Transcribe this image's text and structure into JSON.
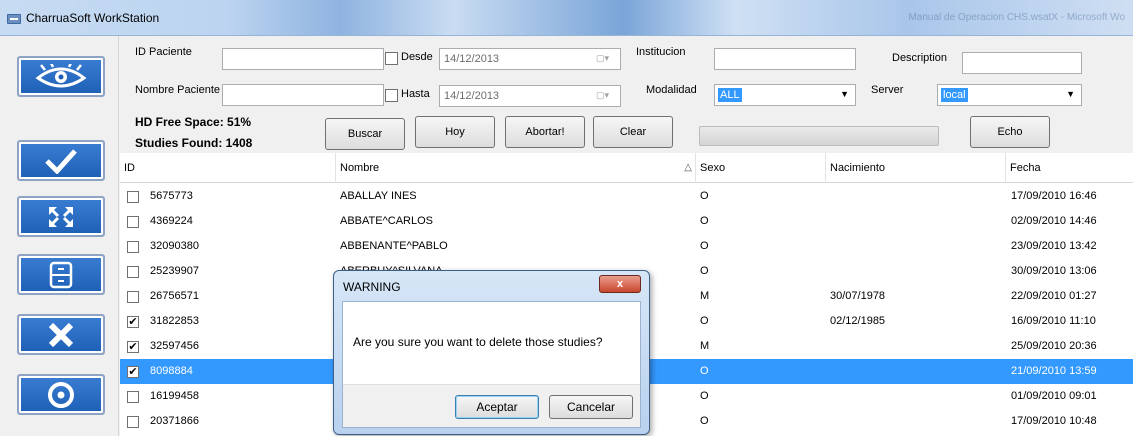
{
  "window": {
    "title": "CharruaSoft WorkStation",
    "ghost_title": "Manual de Operacion CHS.wsatX - Microsoft Wo"
  },
  "sidebar": {
    "buttons": [
      {
        "name": "view-button",
        "icon": "eye-icon"
      },
      {
        "name": "select-button",
        "icon": "checkmark-icon"
      },
      {
        "name": "expand-button",
        "icon": "expand-icon"
      },
      {
        "name": "archive-button",
        "icon": "cabinet-icon"
      },
      {
        "name": "delete-button",
        "icon": "close-icon"
      },
      {
        "name": "burn-cd-button",
        "icon": "disc-icon"
      }
    ]
  },
  "search": {
    "id_paciente_label": "ID Paciente",
    "id_paciente_value": "",
    "nombre_paciente_label": "Nombre Paciente",
    "nombre_paciente_value": "",
    "desde_label": "Desde",
    "desde_value": "14/12/2013",
    "hasta_label": "Hasta",
    "hasta_value": "14/12/2013",
    "institucion_label": "Institucion",
    "institucion_value": "",
    "description_label": "Description",
    "description_value": "",
    "modalidad_label": "Modalidad",
    "modalidad_value": "ALL",
    "server_label": "Server",
    "server_value": "local",
    "hd_free_space": "HD Free Space: 51%",
    "studies_found": "Studies Found: 1408",
    "buttons": {
      "buscar": "Buscar",
      "hoy": "Hoy",
      "abortar": "Abortar!",
      "clear": "Clear",
      "echo": "Echo"
    }
  },
  "grid": {
    "columns": [
      "ID",
      "Nombre",
      "Sexo",
      "Nacimiento",
      "Fecha"
    ],
    "sort_column": "Sexo",
    "rows": [
      {
        "checked": false,
        "selected": false,
        "id": "5675773",
        "nombre": "ABALLAY INES",
        "sexo": "O",
        "nacimiento": "",
        "fecha": "17/09/2010 16:46"
      },
      {
        "checked": false,
        "selected": false,
        "id": "4369224",
        "nombre": "ABBATE^CARLOS",
        "sexo": "O",
        "nacimiento": "",
        "fecha": "02/09/2010 14:46"
      },
      {
        "checked": false,
        "selected": false,
        "id": "32090380",
        "nombre": "ABBENANTE^PABLO",
        "sexo": "O",
        "nacimiento": "",
        "fecha": "23/09/2010 13:42"
      },
      {
        "checked": false,
        "selected": false,
        "id": "25239907",
        "nombre": "ABERBUY^SILVANA",
        "sexo": "O",
        "nacimiento": "",
        "fecha": "30/09/2010 13:06"
      },
      {
        "checked": false,
        "selected": false,
        "id": "26756571",
        "nombre": "",
        "sexo": "M",
        "nacimiento": "30/07/1978",
        "fecha": "22/09/2010 01:27"
      },
      {
        "checked": true,
        "selected": false,
        "id": "31822853",
        "nombre": "",
        "sexo": "O",
        "nacimiento": "02/12/1985",
        "fecha": "16/09/2010 11:10"
      },
      {
        "checked": true,
        "selected": false,
        "id": "32597456",
        "nombre": "",
        "sexo": "M",
        "nacimiento": "",
        "fecha": "25/09/2010 20:36"
      },
      {
        "checked": true,
        "selected": true,
        "id": "8098884",
        "nombre": "",
        "sexo": "O",
        "nacimiento": "",
        "fecha": "21/09/2010 13:59"
      },
      {
        "checked": false,
        "selected": false,
        "id": "16199458",
        "nombre": "",
        "sexo": "O",
        "nacimiento": "",
        "fecha": "01/09/2010 09:01"
      },
      {
        "checked": false,
        "selected": false,
        "id": "20371866",
        "nombre": "",
        "sexo": "O",
        "nacimiento": "",
        "fecha": "17/09/2010 10:48"
      }
    ]
  },
  "dialog": {
    "title": "WARNING",
    "close_label": "x",
    "message": "Are you sure you want to delete those studies?",
    "accept_label": "Aceptar",
    "cancel_label": "Cancelar"
  },
  "colors": {
    "accent": "#3399ff",
    "sidebar_button": "#1d5fb4"
  }
}
